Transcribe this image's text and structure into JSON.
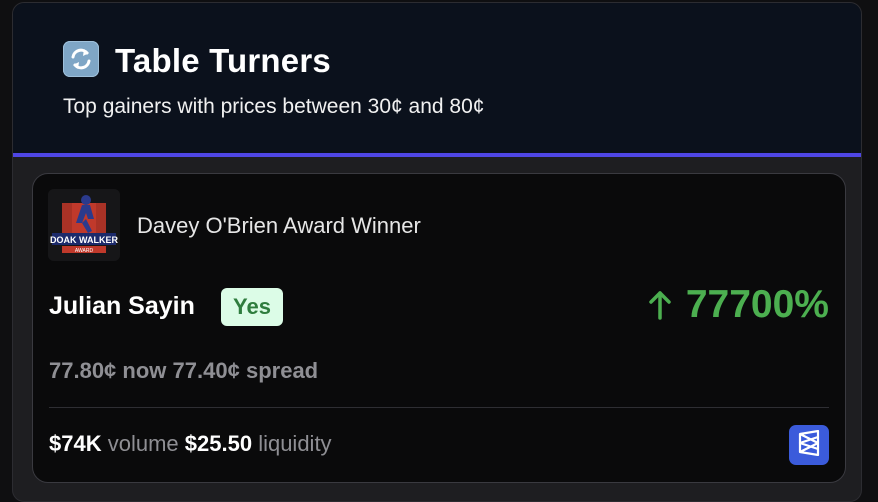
{
  "header": {
    "title": "Table Turners",
    "subtitle": "Top gainers with prices between 30¢ and 80¢",
    "icon": "repeat-arrows-icon",
    "accent_color": "#4f46e5"
  },
  "card": {
    "logo": {
      "icon": "doak-walker-award-logo",
      "text": "DOAK WALKER",
      "subtext": "AWARD"
    },
    "event_title": "Davey O'Brien Award Winner",
    "player_name": "Julian Sayin",
    "outcome_badge": "Yes",
    "change": {
      "arrow_icon": "arrow-up-icon",
      "value": "77700%",
      "color": "#4caf50"
    },
    "prices": {
      "old_price": "77.80¢",
      "now_label": "now",
      "new_price": "77.40¢",
      "spread_label": "spread"
    },
    "stats": {
      "volume_value": "$74K",
      "volume_label": "volume",
      "liquidity_value": "$25.50",
      "liquidity_label": "liquidity"
    },
    "external_link": {
      "icon": "polymarket-icon",
      "color": "#3b5bdb"
    }
  }
}
